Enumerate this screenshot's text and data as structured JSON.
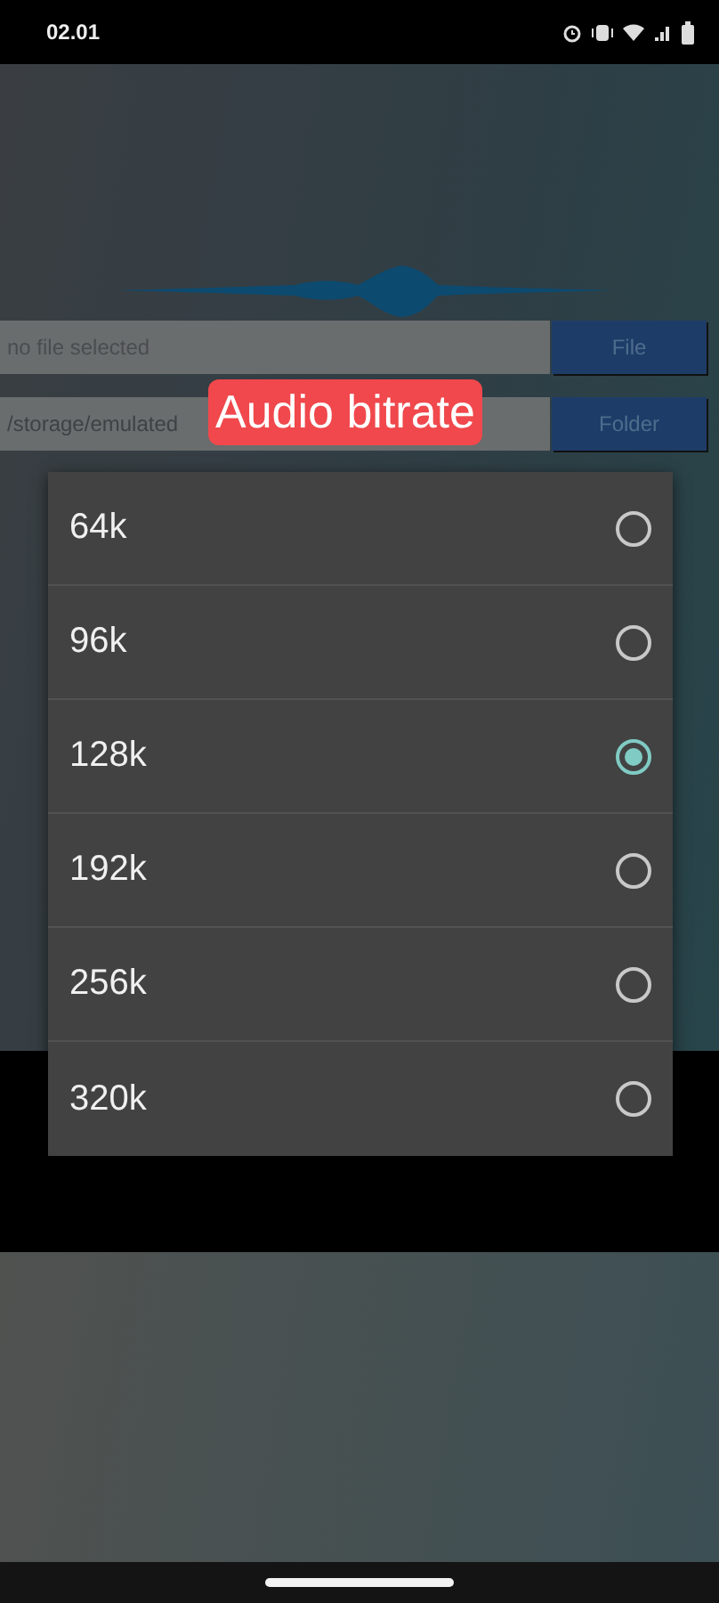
{
  "status_bar": {
    "time": "02.01"
  },
  "file_row": {
    "field": {
      "placeholder": "no file selected"
    },
    "button": "File"
  },
  "folder_row": {
    "field": {
      "value": "/storage/emulated"
    },
    "button": "Folder"
  },
  "dialog": {
    "title": "Audio bitrate",
    "options": [
      {
        "label": "64k",
        "selected": false
      },
      {
        "label": "96k",
        "selected": false
      },
      {
        "label": "128k",
        "selected": true
      },
      {
        "label": "192k",
        "selected": false
      },
      {
        "label": "256k",
        "selected": false
      },
      {
        "label": "320k",
        "selected": false
      }
    ]
  }
}
